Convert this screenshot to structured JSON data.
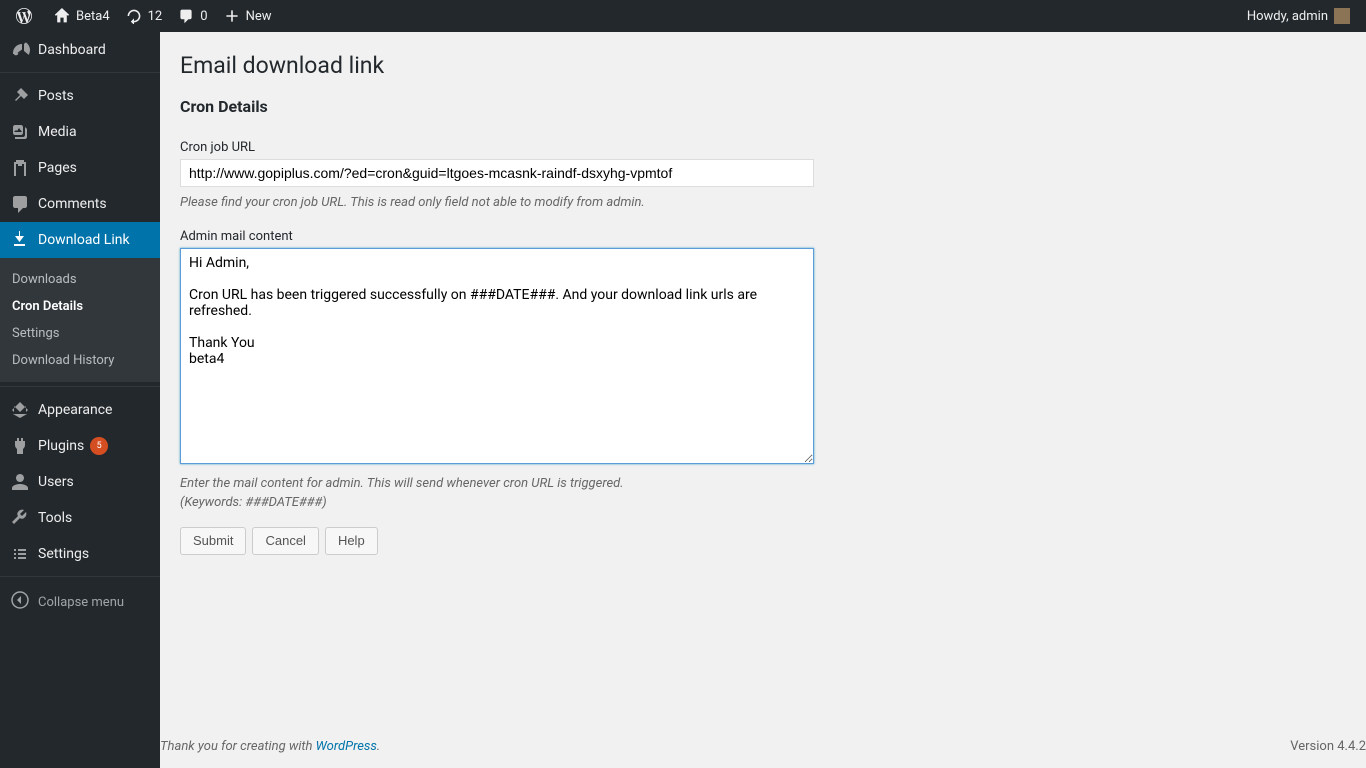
{
  "adminbar": {
    "site_name": "Beta4",
    "updates_count": "12",
    "comments_count": "0",
    "new_label": "New",
    "howdy": "Howdy, admin"
  },
  "sidebar": {
    "dashboard": "Dashboard",
    "posts": "Posts",
    "media": "Media",
    "pages": "Pages",
    "comments": "Comments",
    "download_link": "Download Link",
    "submenu": {
      "downloads": "Downloads",
      "cron_details": "Cron Details",
      "settings": "Settings",
      "download_history": "Download History"
    },
    "appearance": "Appearance",
    "plugins": "Plugins",
    "plugins_count": "5",
    "users": "Users",
    "tools": "Tools",
    "settings": "Settings",
    "collapse": "Collapse menu"
  },
  "page": {
    "title": "Email download link",
    "section": "Cron Details",
    "cron_url_label": "Cron job URL",
    "cron_url_value": "http://www.gopiplus.com/?ed=cron&guid=ltgoes-mcasnk-raindf-dsxyhg-vpmtof",
    "cron_url_help": "Please find your cron job URL. This is read only field not able to modify from admin.",
    "mail_label": "Admin mail content",
    "mail_value": "Hi Admin,\n\nCron URL has been triggered successfully on ###DATE###. And your download link urls are refreshed.\n\nThank You\nbeta4",
    "mail_help1": "Enter the mail content for admin. This will send whenever cron URL is triggered.",
    "mail_help2": "(Keywords: ###DATE###)",
    "submit": "Submit",
    "cancel": "Cancel",
    "help": "Help"
  },
  "footer": {
    "thanks_prefix": "Thank you for creating with ",
    "wordpress": "WordPress",
    "version": "Version 4.4.2"
  }
}
